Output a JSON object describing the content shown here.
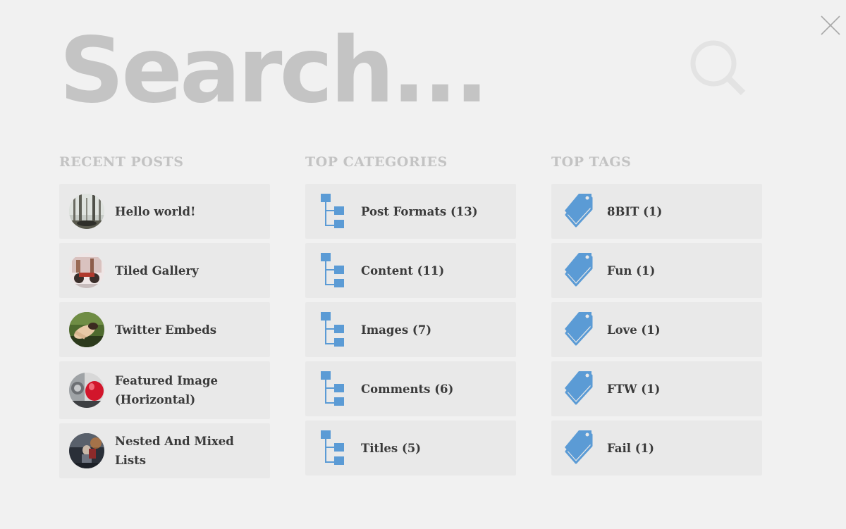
{
  "search": {
    "placeholder": "Search..."
  },
  "accent_color": "#5b9bd5",
  "columns": {
    "recent_posts": {
      "heading": "RECENT POSTS",
      "items": [
        {
          "label": "Hello world!",
          "thumb": "forest-photo"
        },
        {
          "label": "Tiled Gallery",
          "thumb": "motorcycle-photo"
        },
        {
          "label": "Twitter Embeds",
          "thumb": "person-photo"
        },
        {
          "label": "Featured Image (Horizontal)",
          "thumb": "red-motorcycle-photo"
        },
        {
          "label": "Nested And Mixed Lists",
          "thumb": "poster-photo"
        }
      ]
    },
    "top_categories": {
      "heading": "TOP CATEGORIES",
      "items": [
        {
          "label": "Post Formats (13)",
          "icon": "category-tree-icon"
        },
        {
          "label": "Content (11)",
          "icon": "category-tree-icon"
        },
        {
          "label": "Images (7)",
          "icon": "category-tree-icon"
        },
        {
          "label": "Comments (6)",
          "icon": "category-tree-icon"
        },
        {
          "label": "Titles (5)",
          "icon": "category-tree-icon"
        }
      ]
    },
    "top_tags": {
      "heading": "TOP TAGS",
      "items": [
        {
          "label": "8BIT (1)",
          "icon": "tags-icon"
        },
        {
          "label": "Fun (1)",
          "icon": "tags-icon"
        },
        {
          "label": "Love (1)",
          "icon": "tags-icon"
        },
        {
          "label": "FTW (1)",
          "icon": "tags-icon"
        },
        {
          "label": "Fail (1)",
          "icon": "tags-icon"
        }
      ]
    }
  }
}
